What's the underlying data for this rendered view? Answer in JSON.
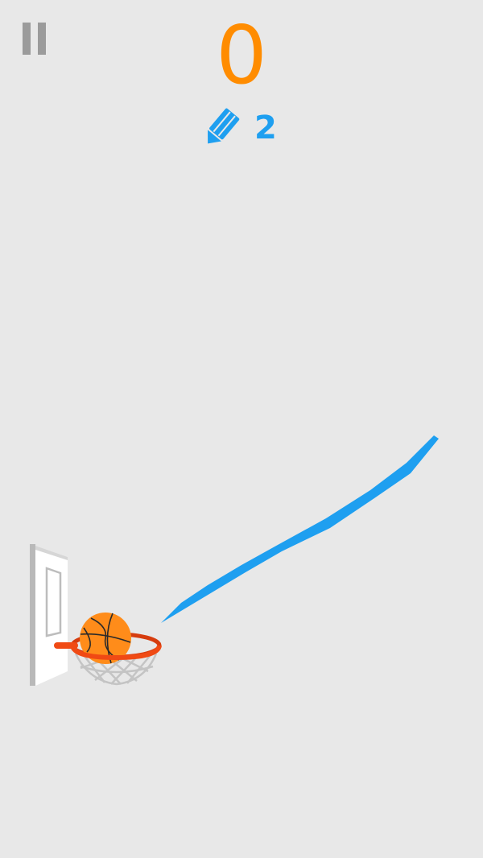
{
  "game": {
    "score": "0",
    "pencils_left": "2"
  },
  "colors": {
    "background": "#e8e8e8",
    "score": "#ff8c00",
    "ink": "#1e9ff0",
    "pause": "#9b9b9b",
    "rim": "#f04a14",
    "ball": "#ff8c1a"
  },
  "icons": {
    "pause": "pause-icon",
    "pencil": "pencil-icon",
    "ball": "basketball-icon"
  }
}
